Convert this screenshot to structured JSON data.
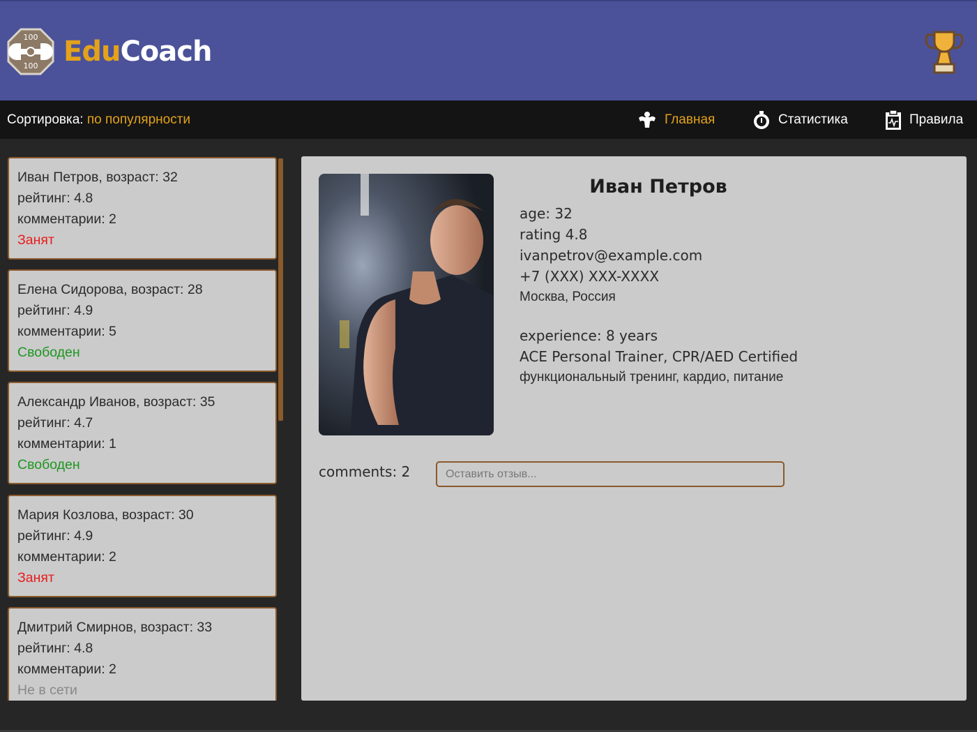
{
  "app": {
    "logo_part1": "Edu",
    "logo_part2": "Coach",
    "logo_badge_top": "100",
    "logo_badge_bottom": "100"
  },
  "colors": {
    "header_bg": "#4b5299",
    "accent": "#e3a21a",
    "busy": "#e81d1d",
    "free": "#1e9620",
    "offline": "#888888",
    "card_border": "#8a5a2b"
  },
  "sort": {
    "label": "Сортировка:",
    "value": "по популярности"
  },
  "nav": [
    {
      "label": "Главная",
      "icon": "muscle-icon",
      "active": true
    },
    {
      "label": "Статистика",
      "icon": "stopwatch-icon",
      "active": false
    },
    {
      "label": "Правила",
      "icon": "clipboard-icon",
      "active": false
    }
  ],
  "coaches": [
    {
      "title": "Иван Петров, возраст: 32",
      "rating": "рейтинг: 4.8",
      "comments": "комментарии: 2",
      "status": "Занят",
      "status_type": "busy"
    },
    {
      "title": "Елена Сидорова, возраст: 28",
      "rating": "рейтинг: 4.9",
      "comments": "комментарии: 5",
      "status": "Свободен",
      "status_type": "free"
    },
    {
      "title": "Александр Иванов, возраст: 35",
      "rating": "рейтинг: 4.7",
      "comments": "комментарии: 1",
      "status": "Свободен",
      "status_type": "free"
    },
    {
      "title": "Мария Козлова, возраст: 30",
      "rating": "рейтинг: 4.9",
      "comments": "комментарии: 2",
      "status": "Занят",
      "status_type": "busy"
    },
    {
      "title": "Дмитрий Смирнов, возраст: 33",
      "rating": "рейтинг: 4.8",
      "comments": "комментарии: 2",
      "status": "Не в сети",
      "status_type": "offline"
    }
  ],
  "detail": {
    "name": "Иван Петров",
    "age": "age: 32",
    "rating": "rating 4.8",
    "email": "ivanpetrov@example.com",
    "phone": "+7 (XXX) XXX-XXXX",
    "location": "Москва, Россия",
    "experience": "experience: 8 years",
    "certifications": "ACE Personal Trainer, CPR/AED Certified",
    "specialization": "функциональный тренинг, кардио, питание",
    "comments_label": "comments: 2",
    "comment_placeholder": "Оставить отзыв..."
  }
}
